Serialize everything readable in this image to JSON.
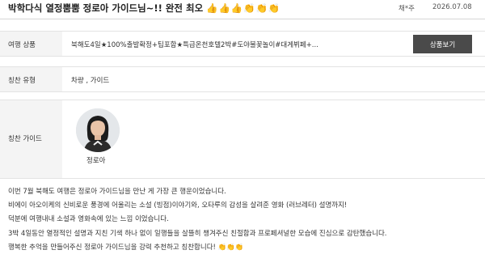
{
  "header": {
    "title": "박학다식 열정뿜뿜 정로아 가이드님~!! 완전 최오",
    "title_emoji": "👍👍👍👏👏👏",
    "author": "채*주",
    "date": "2026.07.08"
  },
  "product": {
    "label": "여행 상품",
    "value": "북해도4일★100%출발확정+팁포함★특급온천호텔2박#도야불꽃놀이#대게뷔페+...",
    "button_label": "상품보기"
  },
  "praise_type": {
    "label": "칭찬 유형",
    "value": "차량 , 가이드"
  },
  "praise_guide": {
    "label": "칭찬 가이드",
    "name": "정로아"
  },
  "review": {
    "paragraphs": [
      "이번 7월 북해도 여행은 정로아 가이드님을 만난 게 가장 큰 행운이었습니다.",
      "비에이 아오이케의 신비로운 풍경에 어울리는 소설 (빙점)이야기와, 오타루의 감성을 살려준 영화 (러브레터) 설명까지!",
      "덕분에 여행내내 소설과 영화속에 있는 느낌 이었습니다.",
      "3박 4일동안 열정적인 설명과 지친 기색 하나 없이 일행들을 살뜰히 챙겨주신 친절함과 프로페셔널한 모습에 진심으로 감탄했습니다.",
      "행복한 추억을 만들어주신 정로아 가이드님을 강력 추천하고 칭찬합니다!"
    ],
    "last_emoji": "👏👏👏"
  },
  "colors": {
    "button_bg": "#4a4a4a",
    "label_bg": "#f4f4f4",
    "border": "#e3e3e3"
  }
}
